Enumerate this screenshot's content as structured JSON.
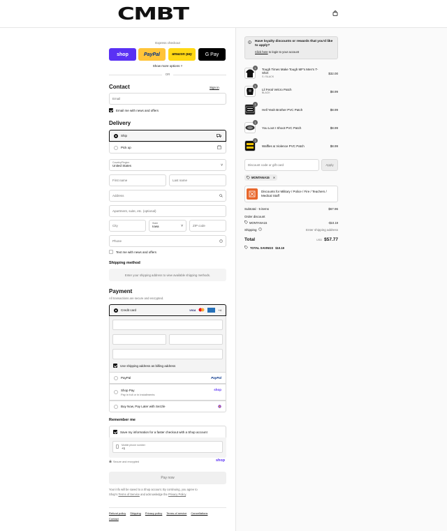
{
  "header": {
    "logo": "CMBT"
  },
  "express": {
    "label": "Express checkout",
    "shop": "shop",
    "paypal": "PayPal",
    "amazon": "amazon pay",
    "gpay": "G Pay",
    "more": "Show more options ˅",
    "or": "OR"
  },
  "contact": {
    "title": "Contact",
    "sign_in": "Sign in",
    "email_placeholder": "Email",
    "email_news": "Email me with news and offers"
  },
  "delivery": {
    "title": "Delivery",
    "ship": "Ship",
    "pickup": "Pick up",
    "country_label": "Country/Region",
    "country": "United States",
    "first_name": "First name",
    "last_name": "Last name",
    "address": "Address",
    "apartment": "Apartment, suite, etc. (optional)",
    "city": "City",
    "state_label": "State",
    "state": "Iowa",
    "zip": "ZIP code",
    "phone": "Phone",
    "text_news": "Text me with news and offers"
  },
  "shipping_method": {
    "title": "Shipping method",
    "note": "Enter your shipping address to view available shipping methods."
  },
  "payment": {
    "title": "Payment",
    "secure": "All transactions are secure and encrypted.",
    "credit_card": "Credit card",
    "visa": "VISA",
    "more_cards": "+4",
    "use_shipping": "Use shipping address as billing address",
    "paypal": "PayPal",
    "paypal_logo": "PayPal",
    "shop_pay": "Shop Pay",
    "shop_pay_sub": "Pay in full or in installments",
    "shop_logo": "shop",
    "sezzle": "Buy Now, Pay Later with Sezzle"
  },
  "remember": {
    "title": "Remember me",
    "save": "Save my information for a faster checkout with a Shop account",
    "mobile_label": "Mobile phone number",
    "mobile_prefix": "+1",
    "secure": "Secure and encrypted",
    "shop_logo": "shop"
  },
  "pay_now": "Pay now",
  "legal": {
    "line1": "Your info will be saved to a Shop account. By continuing, you agree to",
    "line2a": "Shop's",
    "terms": "Terms of Service",
    "line2b": "and acknowledge the",
    "privacy": "Privacy Policy",
    "line2c": "."
  },
  "footer": [
    "Refund policy",
    "Shipping",
    "Privacy policy",
    "Terms of service",
    "Cancellations",
    "Contact"
  ],
  "loyalty": {
    "title": "Have loyalty discounts or rewards that you'd like to apply?",
    "link": "Click here",
    "rest": " to login to your account"
  },
  "items": [
    {
      "name": "Tough Times Make Tough MF's Men's T-Shirt",
      "variant": "S / BLACK",
      "price": "$32.00",
      "qty": "1"
    },
    {
      "name": "Lil Feral Velcro Patch",
      "variant": "BLACK",
      "price": "$8.99",
      "qty": "1"
    },
    {
      "name": "Hell Yeah Brother PVC Patch",
      "variant": "",
      "price": "$8.99",
      "qty": "1"
    },
    {
      "name": "You Loot I Shoot PVC Patch",
      "variant": "",
      "price": "$8.99",
      "qty": "1"
    },
    {
      "name": "Waffles & Violence PVC Patch",
      "variant": "",
      "price": "$8.99",
      "qty": "1"
    }
  ],
  "discount": {
    "placeholder": "Discount code or gift card",
    "apply": "Apply",
    "code": "MONTANA15",
    "military": "Discounts for Military / Police / Fire / Teachers / Medical Staff"
  },
  "totals": {
    "subtotal_label": "Subtotal · 5 items",
    "subtotal": "$67.96",
    "order_discount": "Order discount",
    "code": "MONTANA15",
    "discount": "-$10.19",
    "shipping_label": "Shipping",
    "shipping": "Enter shipping address",
    "total_label": "Total",
    "currency": "USD",
    "total": "$57.77",
    "savings_label": "TOTAL SAVINGS",
    "savings": "$10.19"
  }
}
